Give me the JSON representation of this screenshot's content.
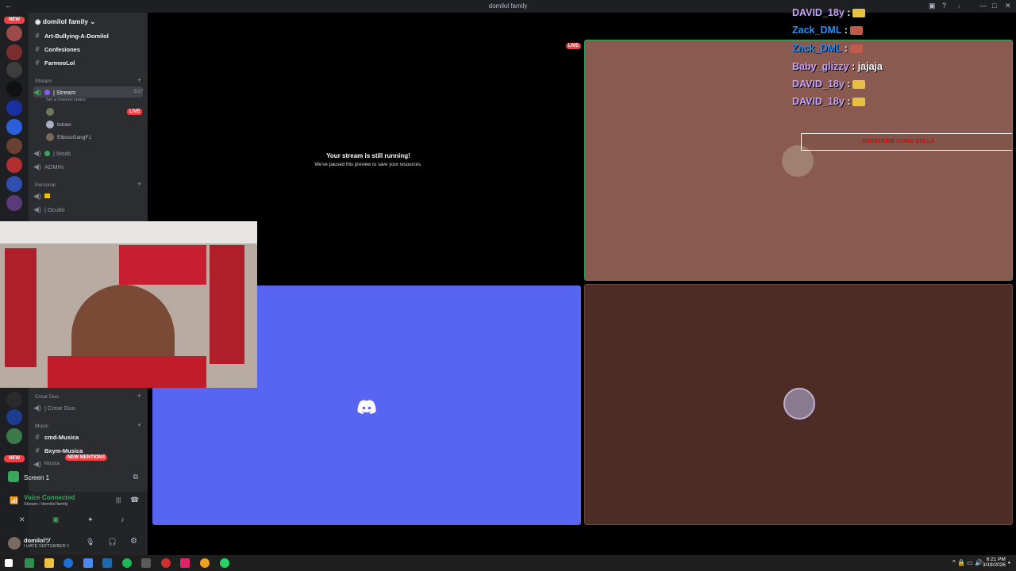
{
  "window": {
    "title": "domilol family"
  },
  "rail": {
    "new_top": "NEW",
    "new_bottom": "NEW"
  },
  "server": {
    "name": "domilol family"
  },
  "channels": {
    "text": [
      "Art-Bullying-A-Domilol",
      "Confesiones",
      "FarmeoLol"
    ],
    "cat_stream": "Stream",
    "stream_channel": "| Stream",
    "stream_count": "3/17",
    "stream_status": "Set a channel status",
    "live_badge": "LIVE",
    "voice_users": [
      "",
      "bdrew",
      "ElbossGangF1"
    ],
    "mods": "| Mods",
    "admin": "ADMIN",
    "cat_personal": "Personal",
    "oculto": "| Oculto",
    "cat_crear": "Crear Duo",
    "crear_channel": "| Crear Duo",
    "cat_music": "Music",
    "music1": "cmd-Musica",
    "music2": "Bxym-Musica",
    "music3": "Musica",
    "new_mentions": "NEW MENTIONS"
  },
  "screen_share": {
    "label": "Screen 1"
  },
  "voice": {
    "status": "Voice Connected",
    "location": "Stream / domilol family"
  },
  "user": {
    "name": "domilolツ",
    "status": "I HATE SEPTEMBER 1"
  },
  "stage": {
    "paused_title": "Your stream is still running!",
    "paused_sub": "We've paused this preview to save your resources.",
    "live": "LIVE"
  },
  "chat": [
    {
      "user": "DAVID_18y",
      "sep": ":",
      "msg": "",
      "color": "#c8a0ff"
    },
    {
      "user": "Zack_DML",
      "sep": ":",
      "msg": "",
      "color": "#1e90ff"
    },
    {
      "user": "Zack_DML",
      "sep": ":",
      "msg": "",
      "color": "#1e90ff"
    },
    {
      "user": "Baby_glizzy",
      "sep": ":",
      "msg": "jajaja",
      "color": "#c8a0ff"
    },
    {
      "user": "DAVID_18y",
      "sep": ":",
      "msg": "",
      "color": "#c8a0ff"
    },
    {
      "user": "DAVID_18y",
      "sep": ":",
      "msg": "",
      "color": "#c8a0ff"
    }
  ],
  "subscribe_banner": "SUBSCRIBE USING DOLLA",
  "clock": {
    "time": "6:21 PM",
    "date": "3/19/2026"
  },
  "colors": {
    "blurple": "#5865f2",
    "top_right_tile": "#8a5a50",
    "bottom_right_tile": "#4d2c26",
    "tile_border": "#3ba55d",
    "live": "#f23f43"
  }
}
